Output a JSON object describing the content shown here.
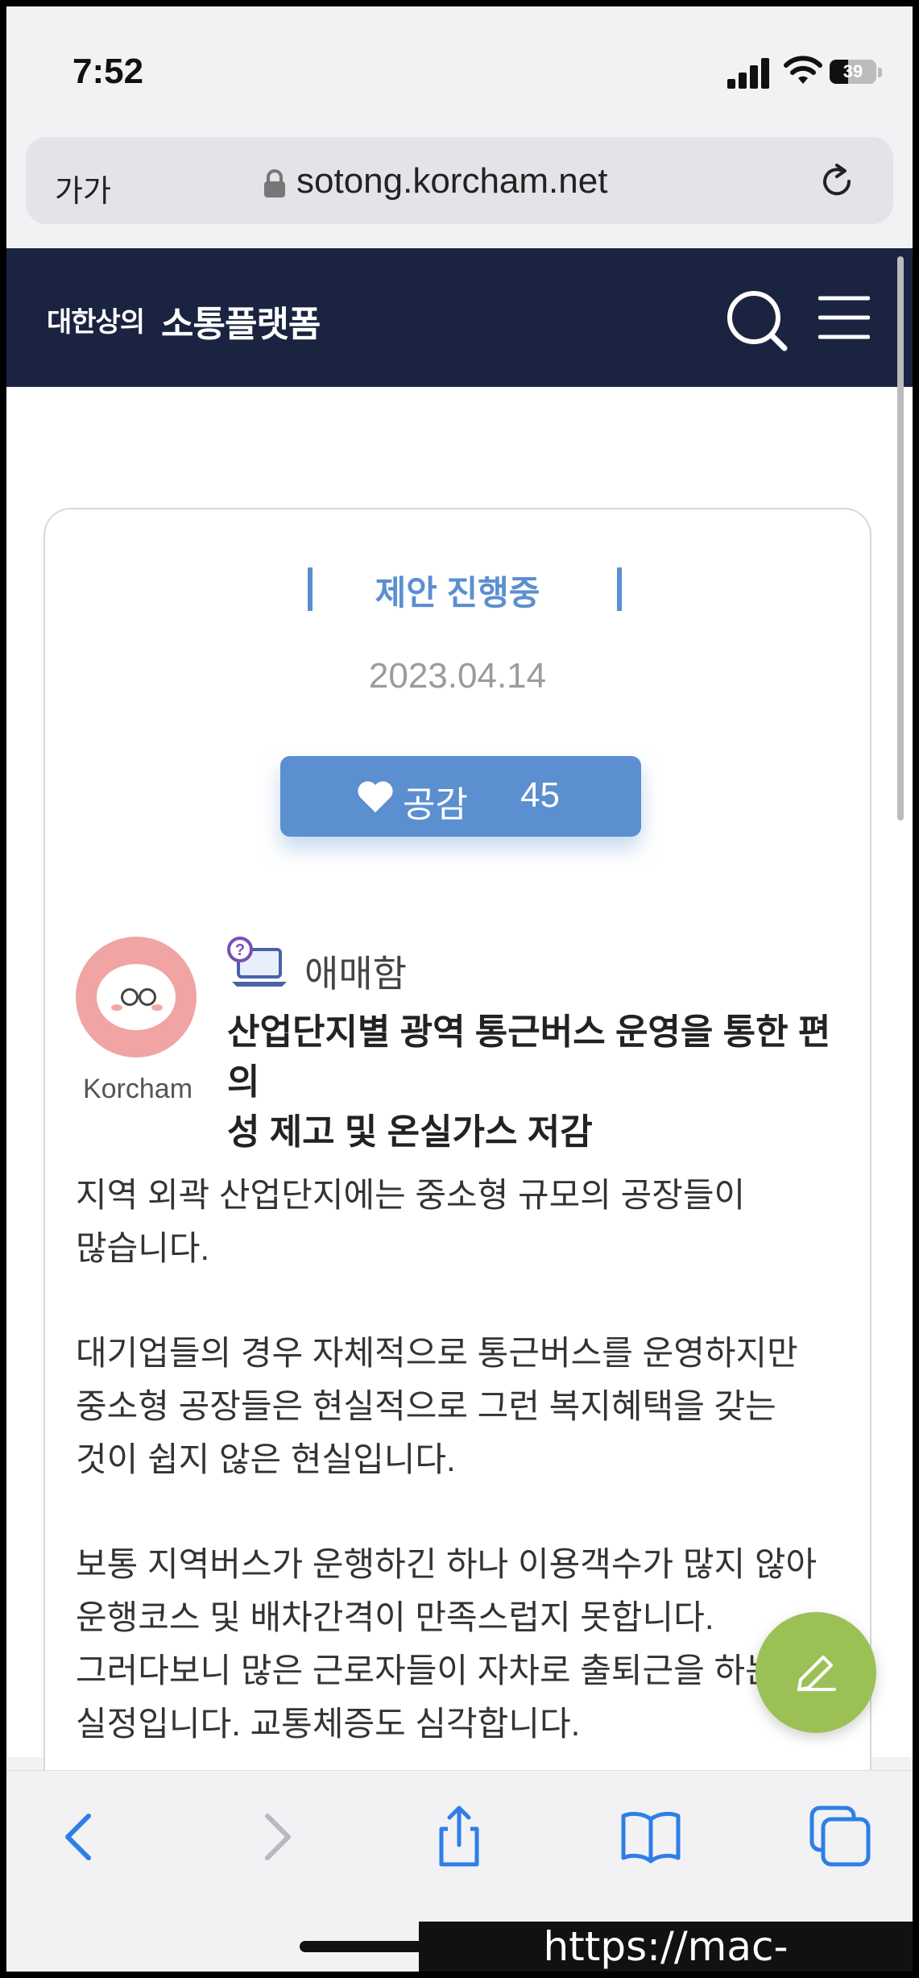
{
  "status_bar": {
    "time": "7:52",
    "battery": "39",
    "battery_level": 0.39
  },
  "browser": {
    "text_size_label": "가가",
    "url": "sotong.korcham.net"
  },
  "site_header": {
    "logo_small": "대한상의",
    "logo_big": "소통플랫폼"
  },
  "post": {
    "status": "제안 진행중",
    "date": "2023.04.14",
    "like_label": "공감",
    "like_count": "45",
    "author": "Korcham",
    "category": "애매함",
    "title_line1": "산업단지별 광역 통근버스 운영을 통한 편의",
    "title_line2": "성 제고 및 온실가스 저감",
    "paragraphs": [
      [
        "지역 외곽 산업단지에는 중소형 규모의 공장들이",
        "많습니다."
      ],
      [
        "대기업들의 경우 자체적으로 통근버스를 운영하지만",
        "중소형 공장들은 현실적으로 그런 복지혜택을 갖는",
        "것이 쉽지 않은 현실입니다."
      ],
      [
        "보통 지역버스가 운행하긴 하나 이용객수가 많지 않아",
        "운행코스 및 배차간격이 만족스럽지 못합니다.",
        "그러다보니 많은 근로자들이 자차로 출퇴근을 하는",
        "실정입니다. 교통체증도 심각합니다."
      ]
    ]
  },
  "colors": {
    "header_bg": "#1a2340",
    "accent": "#5b8fd0",
    "fab": "#9bc156"
  },
  "watermark": "https://mac-os.tistory.com"
}
